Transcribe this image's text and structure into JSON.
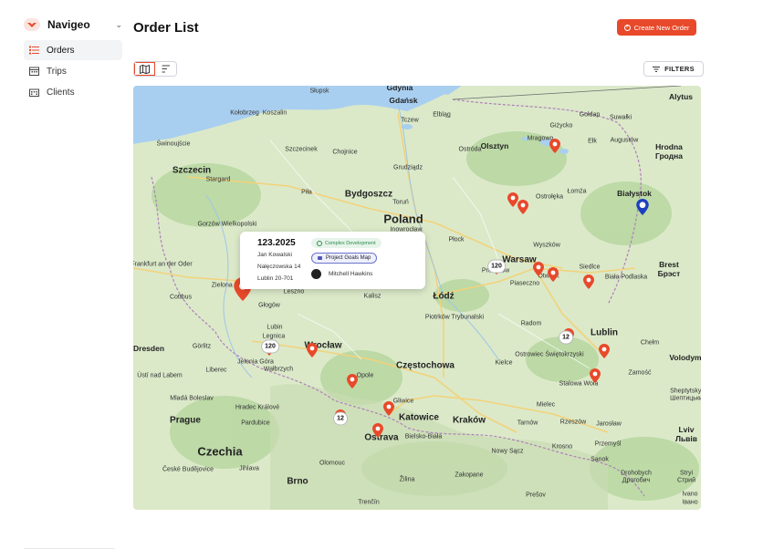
{
  "app": {
    "name": "Navigeo"
  },
  "sidebar": {
    "items": [
      {
        "label": "Orders",
        "icon": "orders-list-icon",
        "active": true
      },
      {
        "label": "Trips",
        "icon": "calendar-icon",
        "active": false
      },
      {
        "label": "Clients",
        "icon": "building-icon",
        "active": false
      }
    ]
  },
  "header": {
    "title": "Order List",
    "create_label": "Create New Order"
  },
  "toolbar": {
    "filters_label": "FILTERS",
    "views": [
      "map-view-icon",
      "list-view-icon"
    ]
  },
  "colors": {
    "accent": "#e8492a",
    "map_land": "#dbe9c9",
    "water": "#a9cff0"
  },
  "map": {
    "labels": [
      "Poland",
      "Czechia",
      "Gdańsk",
      "Gdynia",
      "Słupsk",
      "Koszalin",
      "Kołobrzeg",
      "Elbląg",
      "Olsztyn",
      "Mragowo",
      "Giżycko",
      "Suwałki",
      "Gołdap",
      "Alytus",
      "Augustów",
      "Hrodna",
      "Гродна",
      "Białystok",
      "Ełk",
      "Łomża",
      "Ostrołęka",
      "Szczecin",
      "Stargard",
      "Świnoujście",
      "Szczecinek",
      "Chojnice",
      "Grudziądz",
      "Bydgoszcz",
      "Toruń",
      "Piła",
      "Gorzów Wielkopolski",
      "Inowrocław",
      "Płock",
      "Warsaw",
      "Wyszków",
      "Pruszków",
      "Piaseczno",
      "Otwock",
      "Siedlce",
      "Biała Podlaska",
      "Brest",
      "Брэст",
      "Frankfurt an der Oder",
      "Cottbus",
      "Zielona Góra",
      "Leszno",
      "Kalisz",
      "Łódź",
      "Piotrków Trybunalski",
      "Radom",
      "Lublin",
      "Chełm",
      "Głogów",
      "Legnica",
      "Wrocław",
      "Dresden",
      "Görlitz",
      "Jelenia Góra",
      "Wałbrzych",
      "Opole",
      "Częstochowa",
      "Kielce",
      "Ostrowiec Świętokrzyski",
      "Stalowa Wola",
      "Zamość",
      "Volodymyr",
      "Ústí nad Labem",
      "Liberec",
      "Mladá Boleslav",
      "Hradec Králové",
      "Pardubice",
      "Prague",
      "Gliwice",
      "Katowice",
      "Kraków",
      "Tarnów",
      "Mielec",
      "Rzeszów",
      "Jarosław",
      "Przemyśl",
      "Lviv",
      "Львів",
      "Ostrava",
      "Bielsko-Biała",
      "Nowy Sącz",
      "Krosno",
      "Sanok",
      "Olomouc",
      "Jihlava",
      "Brno",
      "Žilina",
      "Zakopane",
      "Prešov",
      "České Budějovice",
      "Trenčín",
      "Sheptytskyi",
      "Шептицьки",
      "Drohobych",
      "Дрогобич",
      "Stryi",
      "Стрий",
      "Ivano",
      "Івано",
      "Ostróda",
      "Tczew",
      "Lubin"
    ],
    "clusters": [
      "120",
      "120",
      "12",
      "12"
    ]
  },
  "popup": {
    "number": "123.2025",
    "line1": "Jan Kowalski",
    "line2": "Nałęczowska 14",
    "line3": "Lublin 20-701",
    "tag": "Complex Development",
    "goal": "Project Goals Map",
    "person": "Mitchell Hawkins"
  }
}
